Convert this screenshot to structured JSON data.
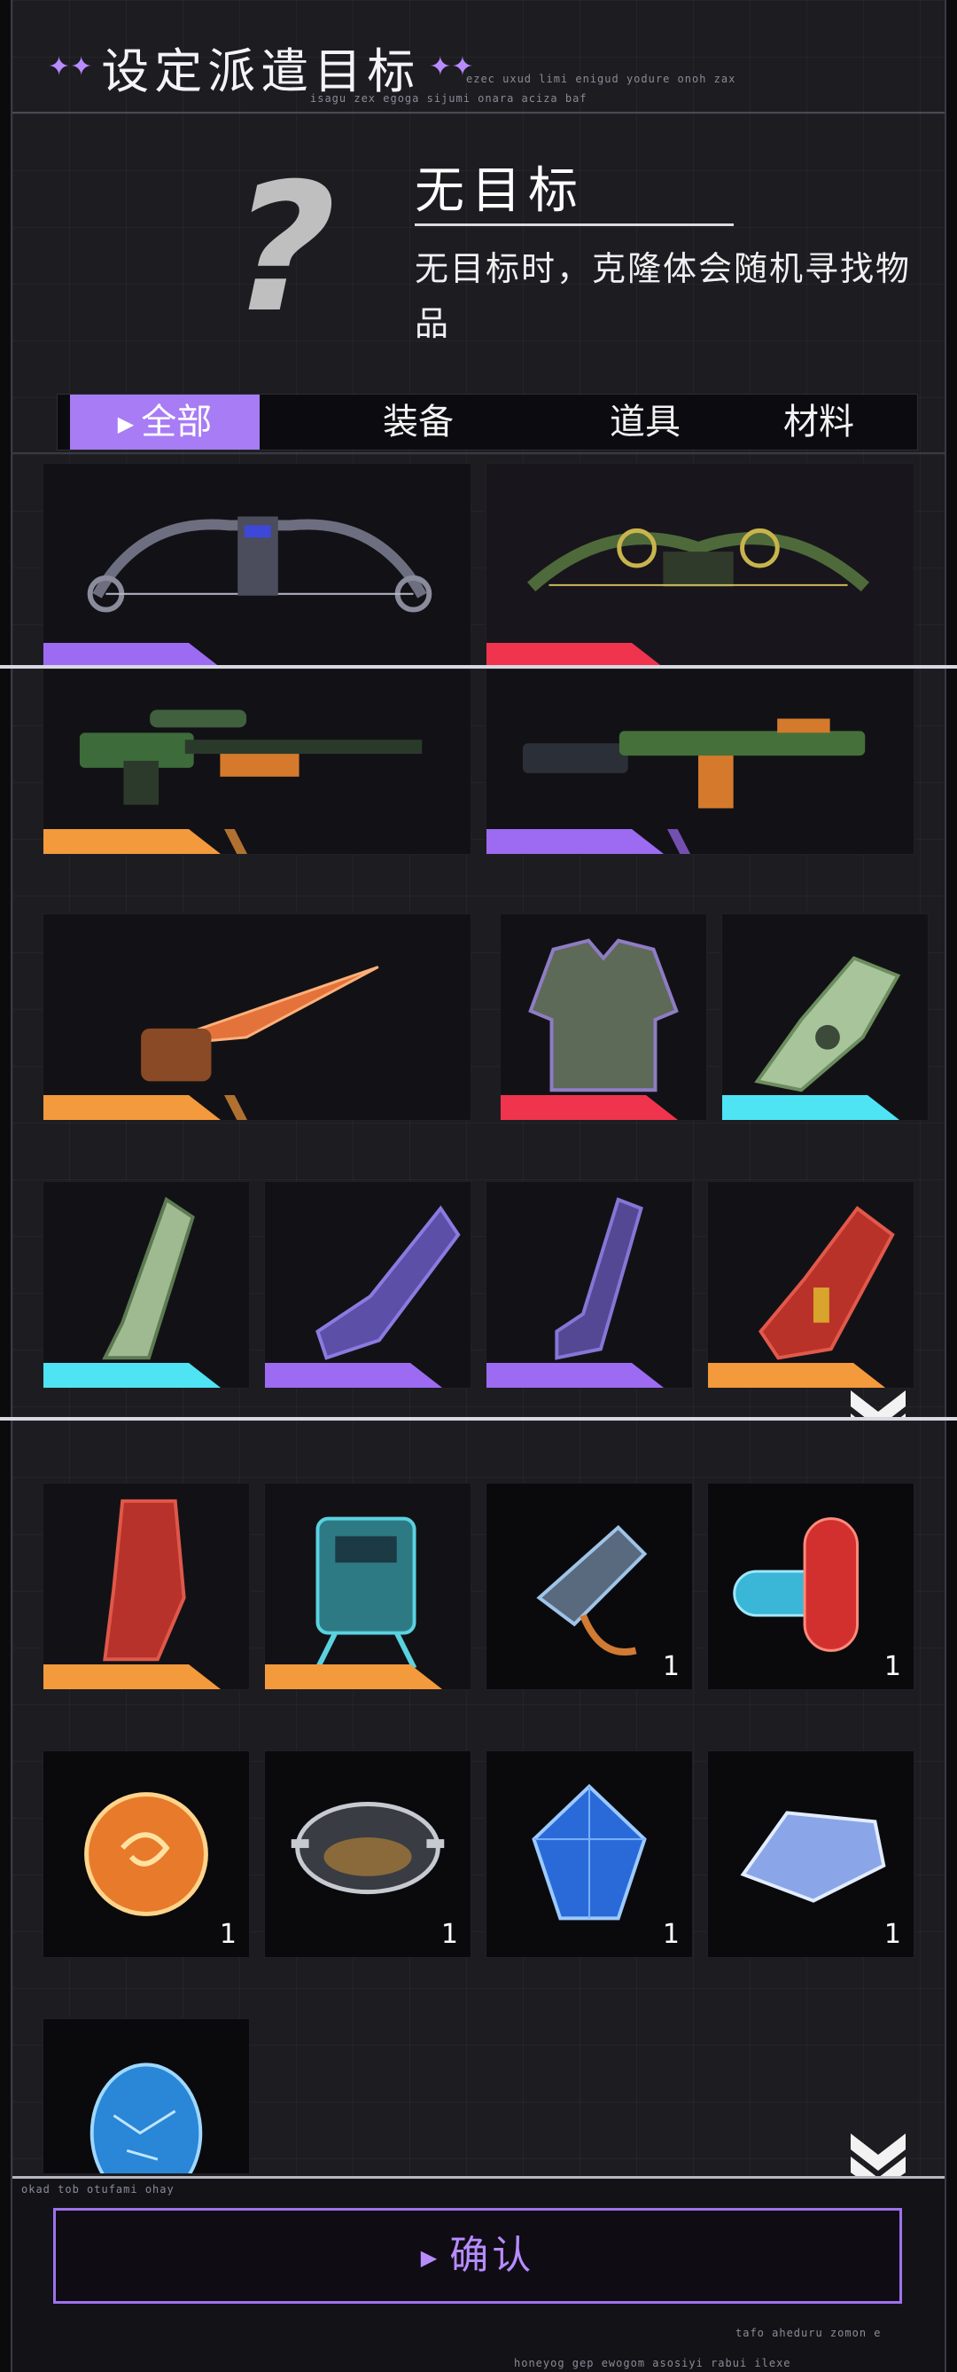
{
  "header": {
    "title": "设定派遣目标",
    "flourish_top": "ezec uxud limi enigud yodure onoh zax",
    "flourish_sub": "isagu zex egoga sijumi onara aciza baf"
  },
  "target": {
    "icon": "question-mark-icon",
    "name": "无目标",
    "description": "无目标时，克隆体会随机寻找物品"
  },
  "tabs": [
    {
      "label": "全部",
      "active": true
    },
    {
      "label": "装备",
      "active": false
    },
    {
      "label": "道具",
      "active": false
    },
    {
      "label": "材料",
      "active": false
    }
  ],
  "colors": {
    "accent": "#a77cf4",
    "rarity_purple": "#9d6bf2",
    "rarity_red": "#f0344e",
    "rarity_orange": "#f39a3c",
    "rarity_cyan": "#4fe4f4"
  },
  "items": [
    {
      "icon": "compound-bow-icon",
      "rarity": "purple",
      "count": ""
    },
    {
      "icon": "green-crossbow-icon",
      "rarity": "red",
      "count": ""
    },
    {
      "icon": "sniper-rifle-icon",
      "rarity": "orange",
      "count": ""
    },
    {
      "icon": "assault-rifle-icon",
      "rarity": "purple",
      "count": ""
    },
    {
      "icon": "blade-icon",
      "rarity": "orange",
      "count": ""
    },
    {
      "icon": "body-armor-icon",
      "rarity": "red",
      "count": ""
    },
    {
      "icon": "green-gauntlet-icon",
      "rarity": "cyan",
      "count": ""
    },
    {
      "icon": "green-leg-armor-icon",
      "rarity": "cyan",
      "count": ""
    },
    {
      "icon": "purple-gauntlet-icon",
      "rarity": "purple",
      "count": ""
    },
    {
      "icon": "purple-leg-armor-icon",
      "rarity": "purple",
      "count": ""
    },
    {
      "icon": "red-gauntlet-icon",
      "rarity": "orange",
      "count": ""
    },
    {
      "icon": "red-boots-icon",
      "rarity": "orange",
      "count": ""
    },
    {
      "icon": "mech-backpack-icon",
      "rarity": "orange",
      "count": ""
    },
    {
      "icon": "whistle-icon",
      "rarity": "none",
      "count": "1"
    },
    {
      "icon": "capsule-pills-icon",
      "rarity": "none",
      "count": "1"
    },
    {
      "icon": "amber-orb-icon",
      "rarity": "none",
      "count": "1"
    },
    {
      "icon": "cooking-pot-icon",
      "rarity": "none",
      "count": "1"
    },
    {
      "icon": "blue-gem-icon",
      "rarity": "none",
      "count": "1"
    },
    {
      "icon": "crystal-shard-icon",
      "rarity": "none",
      "count": "1"
    },
    {
      "icon": "blue-egg-icon",
      "rarity": "none",
      "count": ""
    }
  ],
  "footer": {
    "confirm_label": "确认",
    "flourish_left": "okad tob otufami ohay",
    "flourish_right": "tafo aheduru zomon e",
    "flourish_bottom": "honeyog gep ewogom asosiyi rabui ilexe"
  }
}
